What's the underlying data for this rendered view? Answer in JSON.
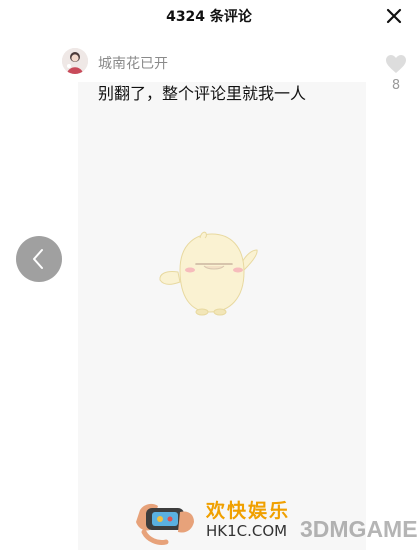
{
  "header": {
    "title": "4324 条评论"
  },
  "comment": {
    "username": "城南花已开",
    "text": "别翻了，整个评论里就我一人",
    "like_count": "8"
  },
  "icons": {
    "close": "close-icon",
    "like": "heart-icon",
    "prev": "chevron-left-icon",
    "avatar": "avatar"
  },
  "watermark": {
    "hk1c_text": "欢快娱乐",
    "hk1c_url": "HK1C.COM",
    "game_site": "3DMGAME"
  },
  "colors": {
    "title": "#111111",
    "username": "#8a8a8a",
    "like": "#dddddd",
    "prev_button": "#808080",
    "watermark_orange": "#f0a000"
  }
}
